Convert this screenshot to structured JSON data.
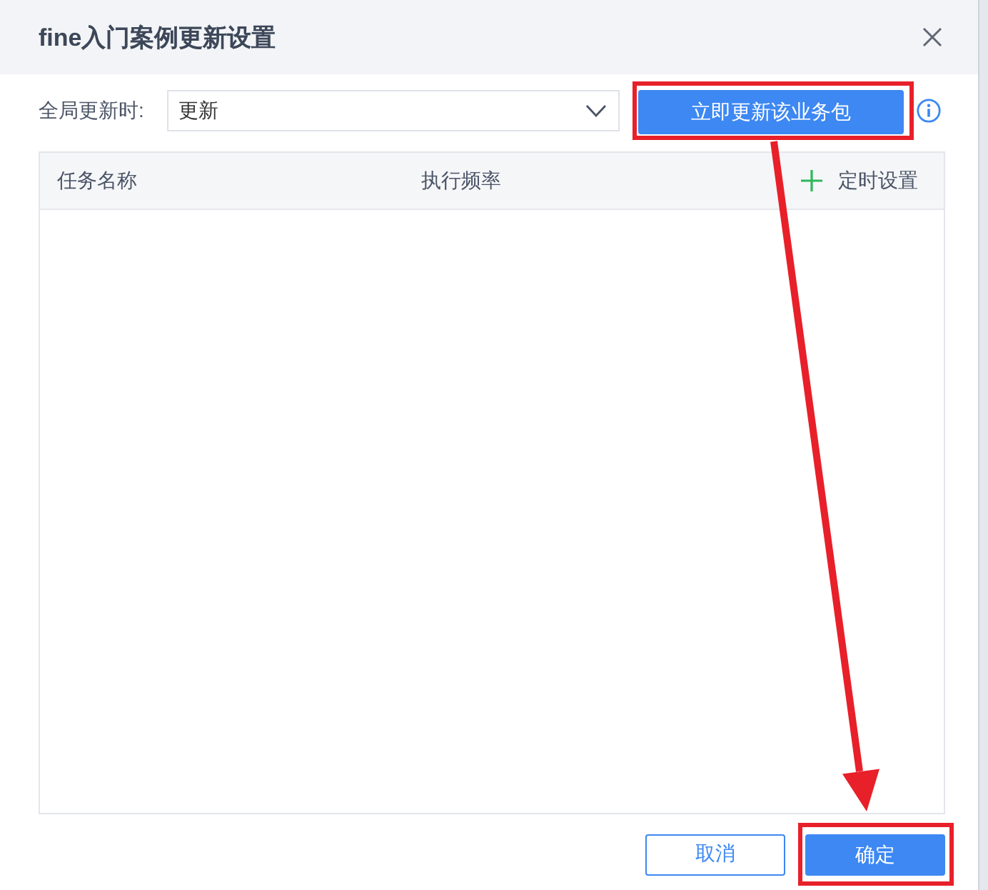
{
  "dialog": {
    "title": "fine入门案例更新设置"
  },
  "global_update": {
    "label": "全局更新时:",
    "value": "更新",
    "button": {
      "label": "立即更新该业务包",
      "highlighted": true
    }
  },
  "table": {
    "columns": [
      "任务名称",
      "执行频率"
    ],
    "add_action": {
      "label": "定时设置"
    }
  },
  "footer": {
    "buttons": [
      {
        "label": "取消",
        "kind": "secondary",
        "highlighted": false
      },
      {
        "label": "确定",
        "kind": "primary",
        "highlighted": true
      }
    ]
  },
  "annotations": {
    "arrow": true
  }
}
